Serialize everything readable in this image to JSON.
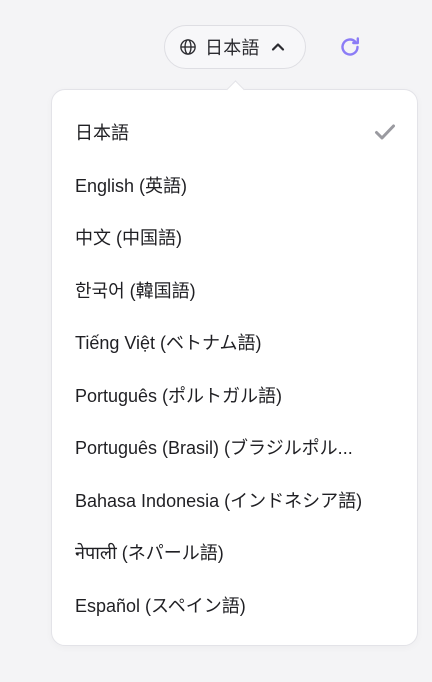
{
  "header": {
    "current_language": "日本語",
    "globe_icon": "globe-icon",
    "chevron_icon": "chevron-up-icon",
    "refresh_icon": "refresh-icon",
    "accent_color": "#8b7cf6"
  },
  "dropdown": {
    "selected_index": 0,
    "check_icon": "check-icon",
    "options": [
      {
        "label": "日本語"
      },
      {
        "label": "English (英語)"
      },
      {
        "label": "中文 (中国語)"
      },
      {
        "label": "한국어 (韓国語)"
      },
      {
        "label": "Tiếng Việt (ベトナム語)"
      },
      {
        "label": "Português (ポルトガル語)"
      },
      {
        "label": "Português (Brasil) (ブラジルポル..."
      },
      {
        "label": "Bahasa Indonesia (インドネシア語)"
      },
      {
        "label": "नेपाली (ネパール語)"
      },
      {
        "label": "Español (スペイン語)"
      }
    ]
  }
}
